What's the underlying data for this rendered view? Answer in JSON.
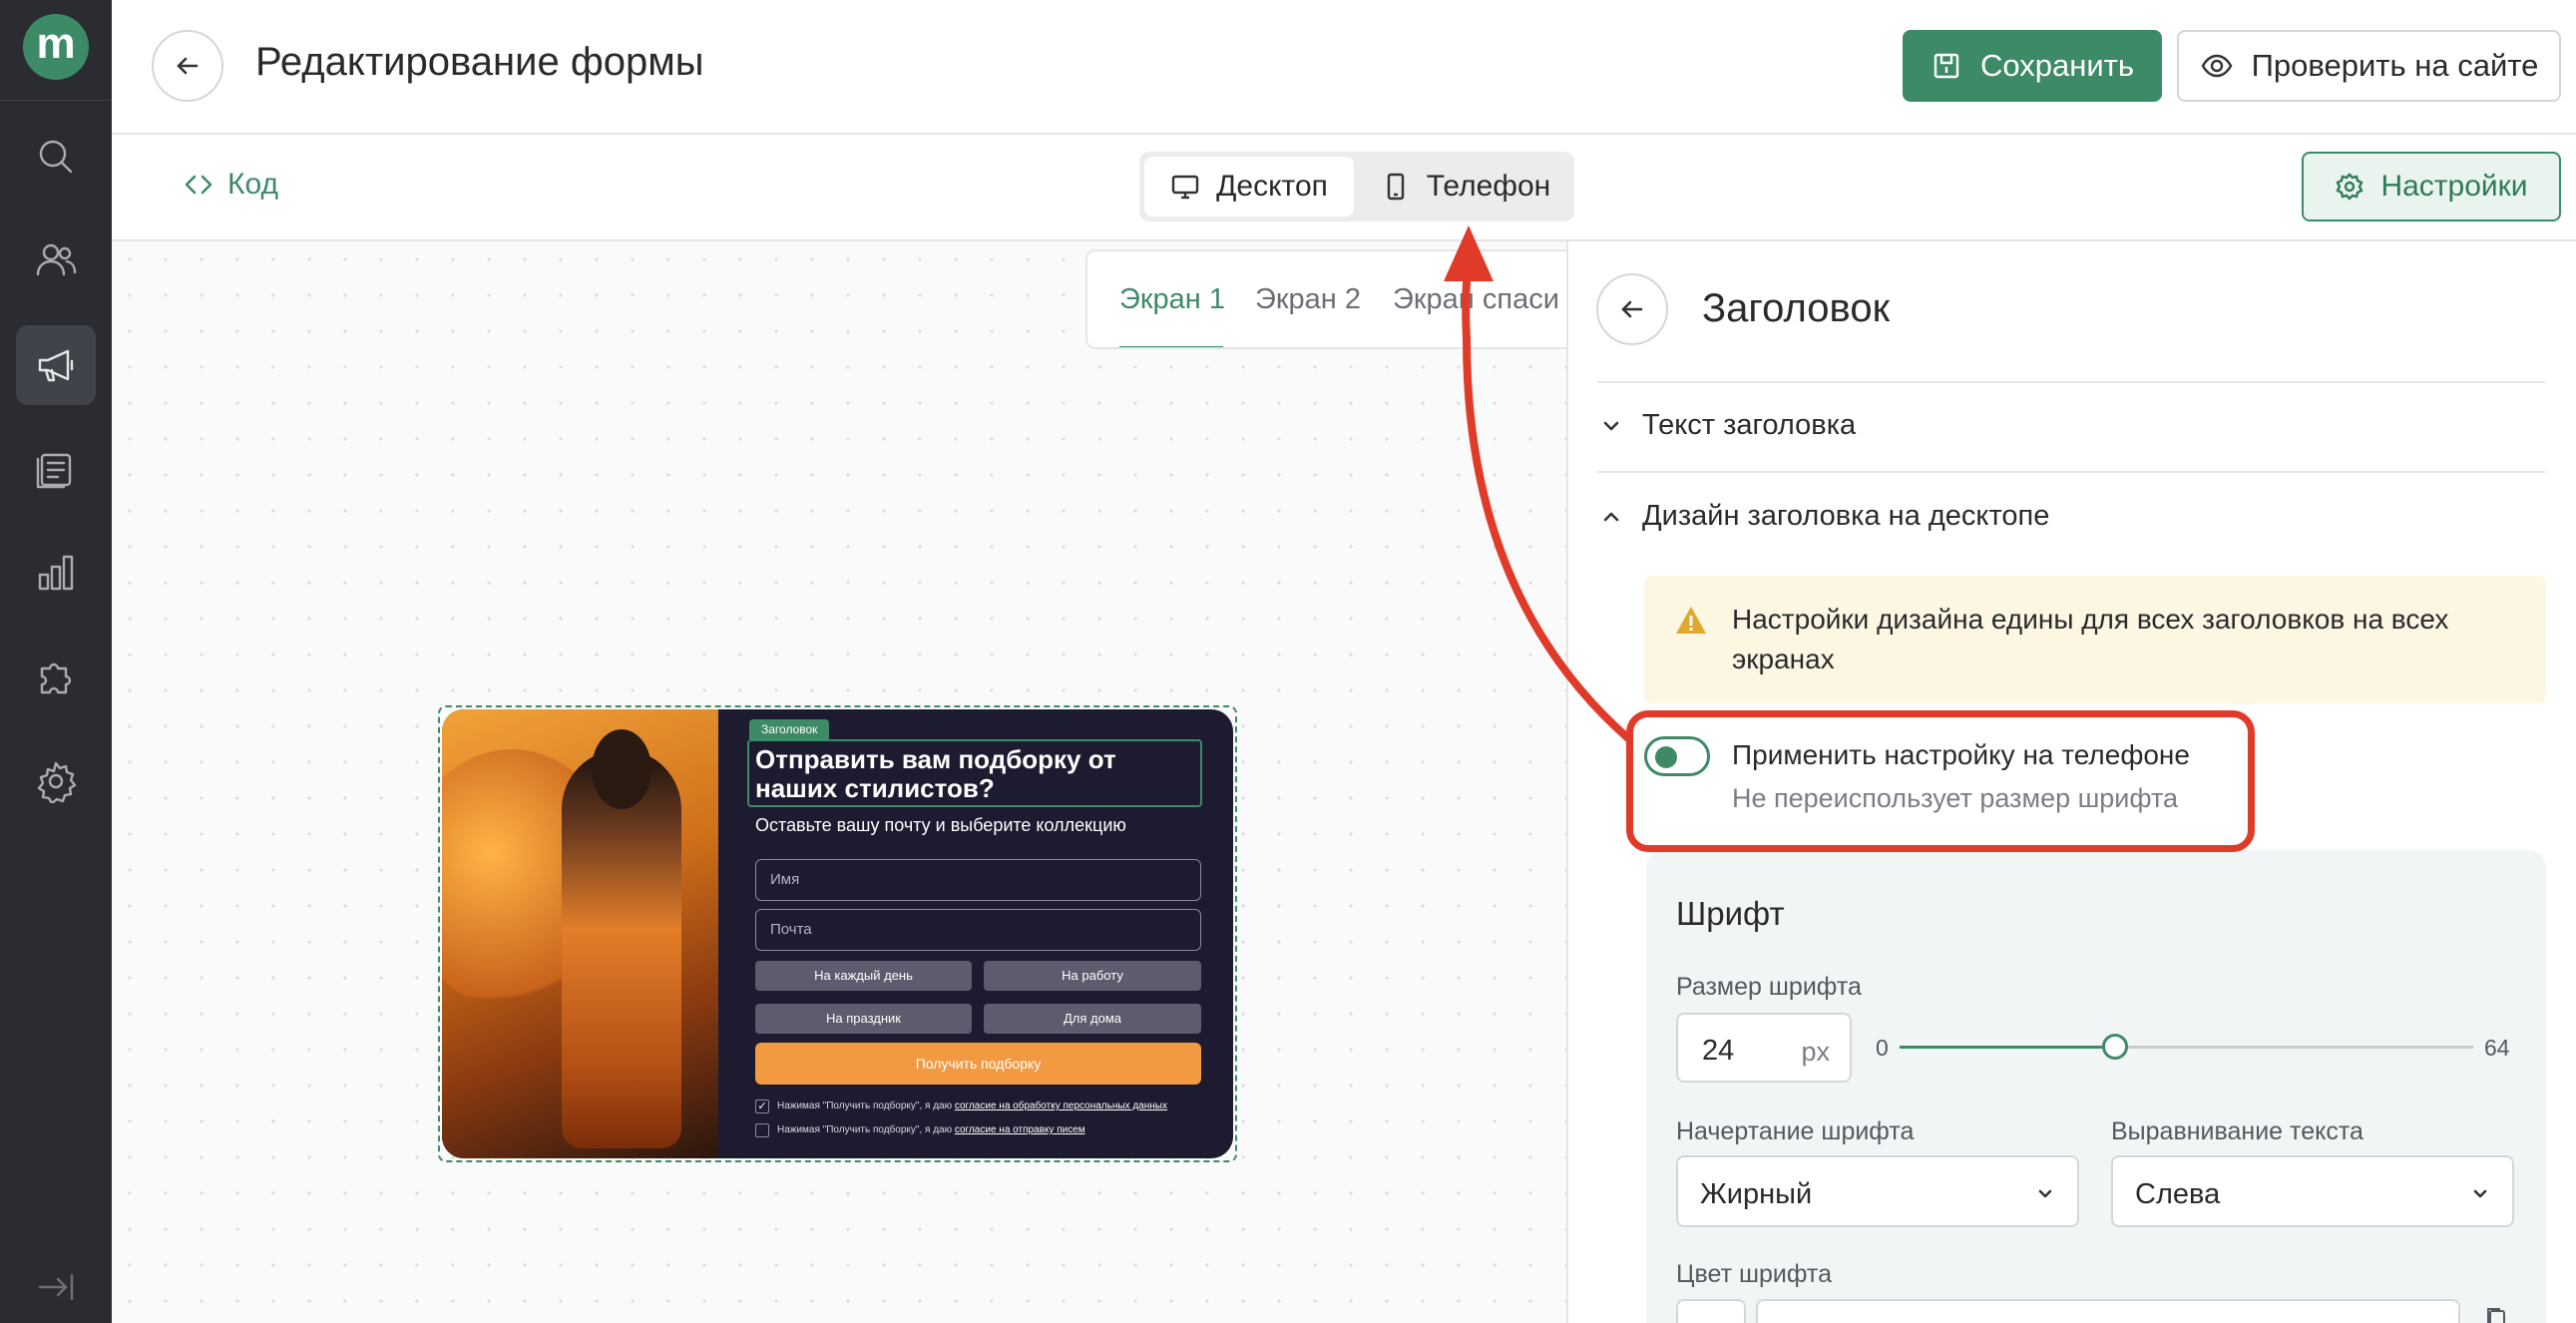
{
  "app": {
    "logo_letter": "m"
  },
  "sidebar": {
    "items": [
      {
        "icon": "search-icon"
      },
      {
        "icon": "users-icon"
      },
      {
        "icon": "megaphone-icon",
        "active": true
      },
      {
        "icon": "forms-icon"
      },
      {
        "icon": "analytics-icon"
      },
      {
        "icon": "integrations-icon"
      },
      {
        "icon": "settings-gear-icon"
      }
    ],
    "collapse_icon": "collapse-icon"
  },
  "header": {
    "title": "Редактирование формы",
    "save_label": "Сохранить",
    "check_label": "Проверить на сайте"
  },
  "toolbar": {
    "code_label": "Код",
    "device_options": [
      {
        "label": "Десктоп",
        "icon": "monitor-icon",
        "selected": true
      },
      {
        "label": "Телефон",
        "icon": "phone-icon",
        "selected": false
      }
    ],
    "settings_label": "Настройки"
  },
  "screens": {
    "tabs": [
      {
        "label": "Экран 1",
        "selected": true
      },
      {
        "label": "Экран 2"
      },
      {
        "label": "Экран спаси"
      }
    ]
  },
  "preview": {
    "badge": "Заголовок",
    "title": "Отправить вам подборку от наших стилистов?",
    "subtitle": "Оставьте вашу почту и выберите коллекцию",
    "name_placeholder": "Имя",
    "email_placeholder": "Почта",
    "chips": [
      "На каждый день",
      "На работу",
      "На праздник",
      "Для дома"
    ],
    "button": "Получить подборку",
    "consent1_prefix": "Нажимая \"Получить подборку\", я даю ",
    "consent1_link": "согласие на обработку персональных данных",
    "consent2_prefix": "Нажимая \"Получить подборку\", я даю ",
    "consent2_link": "согласие на отправку писем",
    "colors": {
      "background": "#1c1b30",
      "button": "#f19a42",
      "chip": "#5c5c6e"
    }
  },
  "panel": {
    "title": "Заголовок",
    "section_text": "Текст заголовка",
    "section_design": "Дизайн заголовка на десктопе",
    "warning": "Настройки дизайна едины для всех заголовков на всех экранах",
    "toggle_label": "Применить настройку на телефоне",
    "toggle_hint": "Не переиспользует размер шрифта",
    "toggle_on": true,
    "font": {
      "heading": "Шрифт",
      "size_label": "Размер шрифта",
      "size_value": "24",
      "size_unit": "px",
      "slider_min": "0",
      "slider_max": "64",
      "slider_value": 24,
      "style_label": "Начертание шрифта",
      "style_value": "Жирный",
      "align_label": "Выравнивание текста",
      "align_value": "Слева",
      "color_label": "Цвет шрифта"
    }
  },
  "colors": {
    "accent": "#3d8a67",
    "annotation": "#e03a28",
    "warning_bg": "#fdf6e3",
    "warning_icon": "#e0a82e"
  }
}
